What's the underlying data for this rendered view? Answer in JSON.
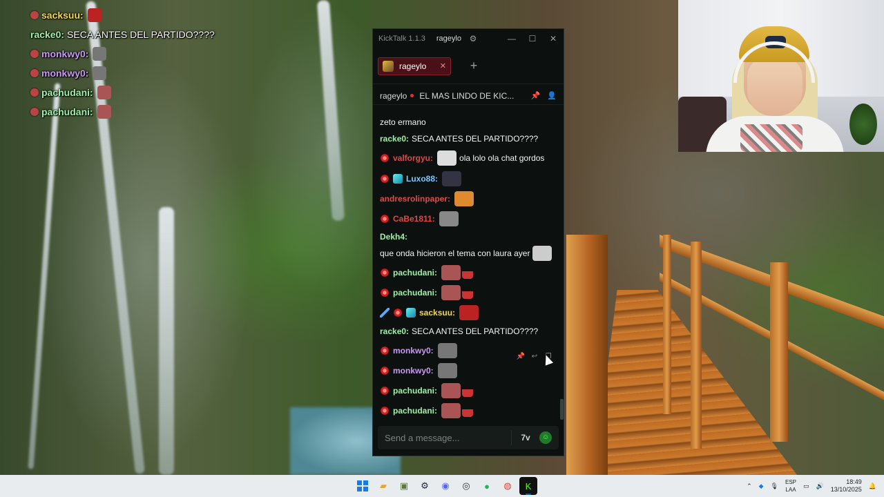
{
  "overlay_chat": [
    {
      "user": "sacksuu:",
      "color": "#f6d94a",
      "text": "",
      "emote_color": "#b22"
    },
    {
      "user": "racke0:",
      "color": "#9ff0a8",
      "text": "SECA ANTES DEL PARTIDO????",
      "emote_color": ""
    },
    {
      "user": "monkwy0:",
      "color": "#c89af0",
      "text": "",
      "emote_color": "#777"
    },
    {
      "user": "monkwy0:",
      "color": "#c89af0",
      "text": "",
      "emote_color": "#777"
    },
    {
      "user": "pachudani:",
      "color": "#9ff0a8",
      "text": "",
      "emote_color": "#a55"
    },
    {
      "user": "pachudani:",
      "color": "#9ff0a8",
      "text": "",
      "emote_color": "#a55"
    }
  ],
  "kicktalk": {
    "app_title": "KickTalk 1.1.3",
    "user": "rageylo",
    "tab_label": "rageylo",
    "add_tab": "+",
    "channel": "rageylo",
    "stream_title": "EL MAS LINDO DE KIC...",
    "input_placeholder": "Send a message...",
    "emote_button": "7v",
    "messages": [
      {
        "user": "",
        "text": "zeto ermano",
        "color": "#fff",
        "badges": []
      },
      {
        "user": "racke0:",
        "text": "SECA ANTES DEL PARTIDO????",
        "color": "#9ff0a8",
        "badges": []
      },
      {
        "user": "valforgyu:",
        "text": "ola lolo ola chat gordos",
        "color": "#e04848",
        "badges": [
          "red"
        ],
        "emote": "#ddd"
      },
      {
        "user": "Luxo88:",
        "text": "",
        "color": "#7ac8ff",
        "badges": [
          "red",
          "cyan"
        ],
        "emote": "#334"
      },
      {
        "user": "andresrolinpaper:",
        "text": "",
        "color": "#e04848",
        "badges": [],
        "emote": "#e08a30"
      },
      {
        "user": "CaBe1811:",
        "text": "",
        "color": "#e04848",
        "badges": [
          "red"
        ],
        "emote": "#888"
      },
      {
        "user": "Dekh4:",
        "text": "que onda hicieron el tema con laura ayer",
        "color": "#9ff0a8",
        "badges": [],
        "emote": "#ccc"
      },
      {
        "user": "pachudani:",
        "text": "",
        "color": "#9ff0a8",
        "badges": [
          "red"
        ],
        "emote": "#a55"
      },
      {
        "user": "pachudani:",
        "text": "",
        "color": "#9ff0a8",
        "badges": [
          "red"
        ],
        "emote": "#a55"
      },
      {
        "user": "sacksuu:",
        "text": "",
        "color": "#f6d94a",
        "badges": [
          "sword",
          "red",
          "cyan"
        ],
        "emote": "#b22"
      },
      {
        "user": "racke0:",
        "text": "SECA ANTES DEL PARTIDO????",
        "color": "#9ff0a8",
        "badges": []
      },
      {
        "user": "monkwy0:",
        "text": "",
        "color": "#c89af0",
        "badges": [
          "red"
        ],
        "emote": "#777"
      },
      {
        "user": "monkwy0:",
        "text": "",
        "color": "#c89af0",
        "badges": [
          "red"
        ],
        "emote": "#777"
      },
      {
        "user": "pachudani:",
        "text": "",
        "color": "#9ff0a8",
        "badges": [
          "red"
        ],
        "emote": "#a55"
      },
      {
        "user": "pachudani:",
        "text": "",
        "color": "#9ff0a8",
        "badges": [
          "red"
        ],
        "emote": "#a55"
      }
    ]
  },
  "taskbar": {
    "apps": [
      "start-icon",
      "file-explorer-icon",
      "app-icon",
      "steam-icon",
      "discord-icon",
      "obs-icon",
      "spotify-icon",
      "chrome-icon",
      "kick-icon"
    ],
    "lang_top": "ESP",
    "lang_bottom": "LAA",
    "time": "18:49",
    "date": "13/10/2025"
  }
}
